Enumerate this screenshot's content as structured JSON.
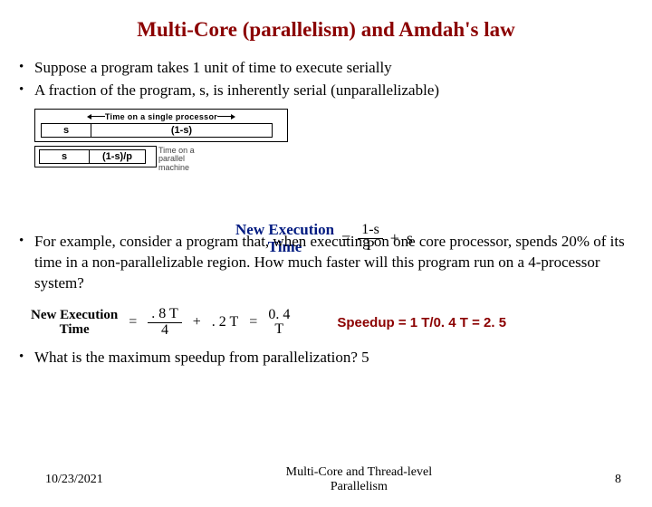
{
  "title": "Multi-Core (parallelism) and Amdah's law",
  "bullets_top": [
    "Suppose a program takes 1 unit of time to execute serially",
    "A fraction of the program, s, is inherently serial (unparallelizable)"
  ],
  "diagram1": {
    "timeline_label": "Time on a single processor",
    "seg_serial": "s",
    "seg_rest": "(1-s)"
  },
  "diagram2": {
    "seg_serial": "s",
    "seg_rest": "(1-s)/p",
    "side_label_1": "Time on a",
    "side_label_2": "parallel",
    "side_label_3": "machine"
  },
  "formula1": {
    "lhs_line1": "New Execution",
    "lhs_line2": "Time",
    "eq": "=",
    "frac_num": "1-s",
    "frac_den": "P",
    "plus": "+",
    "svar": "s"
  },
  "bullet_mid": "For example, consider a program that, when executing on one core processor, spends 20% of its time in a non-parallelizable region. How much faster will this program run on a 4-processor system?",
  "equation": {
    "lhs_line1": "New Execution",
    "lhs_line2": "Time",
    "eq1": "=",
    "t1_num": ". 8 T",
    "t1_den": "4",
    "plus": "+",
    "t2": ". 2 T",
    "eq2": "=",
    "res_num": "0. 4",
    "res_den": "T",
    "speedup": "Speedup = 1 T/0. 4 T = 2. 5"
  },
  "bullet_last": "What is the maximum speedup from parallelization?  5",
  "footer": {
    "date": "10/23/2021",
    "center_line1": "Multi-Core and Thread-level",
    "center_line2": "Parallelism",
    "page": "8"
  }
}
